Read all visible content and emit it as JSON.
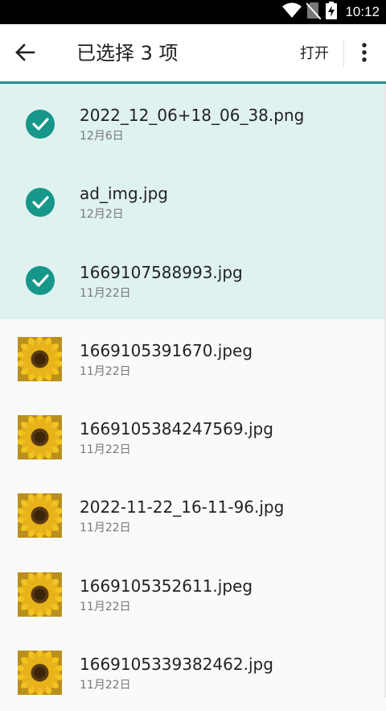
{
  "status_bar": {
    "time": "10:12",
    "icons": [
      "wifi-icon",
      "no-sim-icon",
      "battery-charging-icon"
    ]
  },
  "toolbar": {
    "title": "已选择 3 项",
    "open_label": "打开",
    "back_icon": "arrow-left-icon",
    "more_icon": "more-vert-icon"
  },
  "colors": {
    "accent": "#17968a",
    "selected_bg": "#dff2f0"
  },
  "files": [
    {
      "name": "2022_12_06+18_06_38.png",
      "date": "12月6日",
      "selected": true
    },
    {
      "name": "ad_img.jpg",
      "date": "12月2日",
      "selected": true
    },
    {
      "name": "1669107588993.jpg",
      "date": "11月22日",
      "selected": true
    },
    {
      "name": "1669105391670.jpeg",
      "date": "11月22日",
      "selected": false
    },
    {
      "name": "1669105384247569.jpg",
      "date": "11月22日",
      "selected": false
    },
    {
      "name": "2022-11-22_16-11-96.jpg",
      "date": "11月22日",
      "selected": false
    },
    {
      "name": "1669105352611.jpeg",
      "date": "11月22日",
      "selected": false
    },
    {
      "name": "1669105339382462.jpg",
      "date": "11月22日",
      "selected": false
    }
  ]
}
